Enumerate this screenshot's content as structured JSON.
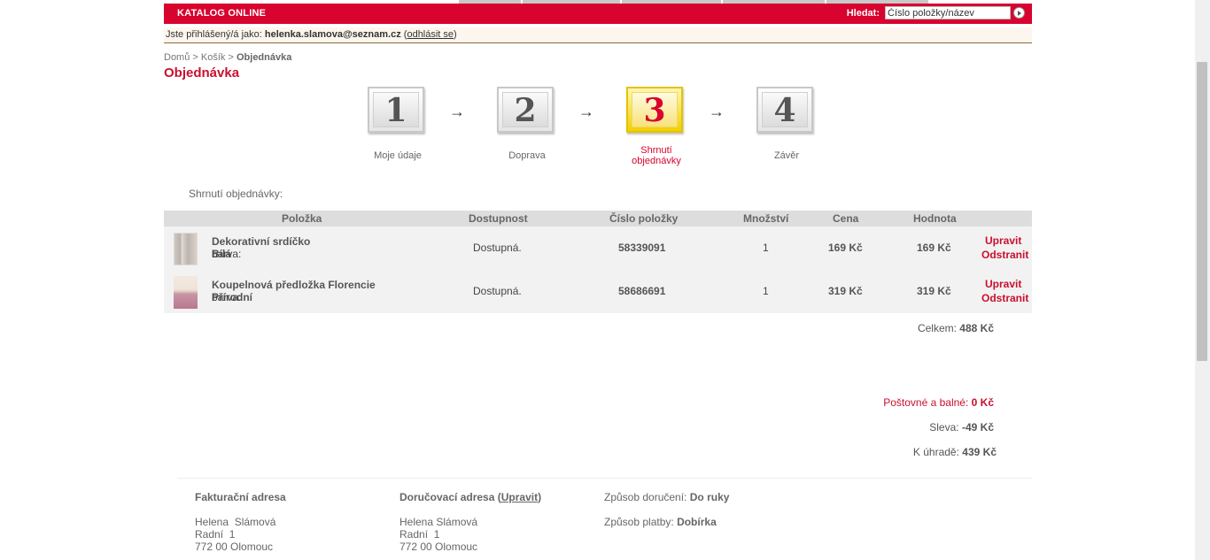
{
  "header": {
    "title": "KATALOG ONLINE",
    "search_label": "Hledat:",
    "search_placeholder": "Číslo položky/název"
  },
  "login": {
    "prefix": "Jste přihlášený/á jako:",
    "email": "helenka.slamova@seznam.cz",
    "logout_label": "odhlásit se"
  },
  "breadcrumb": {
    "home": "Domů",
    "sep1": ">",
    "cart": "Košík",
    "sep2": ">",
    "current": "Objednávka"
  },
  "page_title": "Objednávka",
  "steps": [
    {
      "number": "1",
      "label": "Moje údaje",
      "active": false
    },
    {
      "number": "2",
      "label": "Doprava",
      "active": false
    },
    {
      "number": "3",
      "label_line1": "Shrnutí",
      "label_line2": "objednávky",
      "active": true
    },
    {
      "number": "4",
      "label": "Závěr",
      "active": false
    }
  ],
  "arrow_glyph": "→",
  "summary_title": "Shrnutí objednávky:",
  "table": {
    "columns": [
      "Položka",
      "Dostupnost",
      "Číslo položky",
      "Množství",
      "Cena",
      "Hodnota"
    ],
    "rows": [
      {
        "name": "Dekorativní srdíčko",
        "attr_label": "barva:",
        "attr_value": "Bílá",
        "availability": "Dostupná.",
        "item_number": "58339091",
        "quantity": "1",
        "price": "169 Kč",
        "value": "169 Kč",
        "edit_label": "Upravit",
        "remove_label": "Odstranit"
      },
      {
        "name": "Koupelnová předložka Florencie",
        "attr_label": "barva:",
        "attr_value": "Přírodní",
        "availability": "Dostupná.",
        "item_number": "58686691",
        "quantity": "1",
        "price": "319 Kč",
        "value": "319 Kč",
        "edit_label": "Upravit",
        "remove_label": "Odstranit"
      }
    ]
  },
  "totals": {
    "total_label": "Celkem:",
    "total_value": "488 Kč",
    "postage_label": "Poštovné a balné:",
    "postage_value": "0 Kč",
    "discount_label": "Sleva:",
    "discount_value": "-49 Kč",
    "to_pay_label": "K úhradě:",
    "to_pay_value": "439 Kč"
  },
  "billing": {
    "heading": "Fakturační adresa",
    "name": "Helena  Slámová",
    "street": "Radní  1",
    "city": "772 00 Olomouc"
  },
  "delivery": {
    "heading": "Doručovací adresa",
    "edit_label": "Upravit",
    "name": "Helena Slámová",
    "street": "Radní  1",
    "city": "772 00 Olomouc"
  },
  "methods": {
    "shipping_label": "Způsob doručení:",
    "shipping_value": "Do ruky",
    "payment_label": "Způsob platby:",
    "payment_value": "Dobírka"
  },
  "colors": {
    "brand_red": "#d8032e",
    "active_step_yellow": "#f2d000"
  }
}
